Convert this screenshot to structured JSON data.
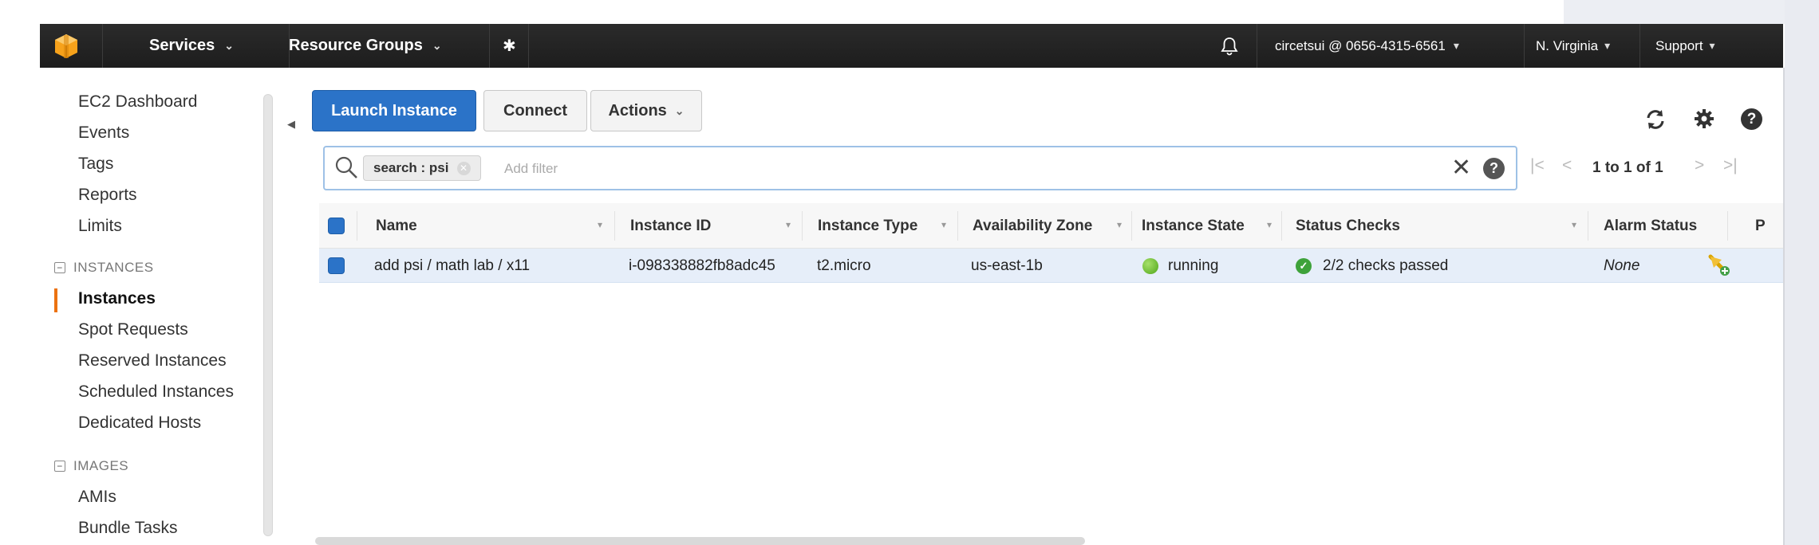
{
  "topbar": {
    "services": "Services",
    "resource_groups": "Resource Groups",
    "pin_icon": "pin-icon",
    "bell_icon": "bell-icon",
    "account": "circetsui @ 0656-4315-6561",
    "region": "N. Virginia",
    "support": "Support"
  },
  "sidebar": {
    "items": [
      "EC2 Dashboard",
      "Events",
      "Tags",
      "Reports",
      "Limits"
    ],
    "instances_group": "INSTANCES",
    "instances_items": [
      "Instances",
      "Spot Requests",
      "Reserved Instances",
      "Scheduled Instances",
      "Dedicated Hosts"
    ],
    "images_group": "IMAGES",
    "images_items": [
      "AMIs",
      "Bundle Tasks"
    ],
    "active": "Instances"
  },
  "toolbar": {
    "launch": "Launch Instance",
    "connect": "Connect",
    "actions": "Actions"
  },
  "search": {
    "token": "search : psi",
    "placeholder": "Add filter"
  },
  "pagination": {
    "text": "1 to 1 of 1"
  },
  "table": {
    "columns": [
      "Name",
      "Instance ID",
      "Instance Type",
      "Availability Zone",
      "Instance State",
      "Status Checks",
      "Alarm Status",
      "P"
    ],
    "rows": [
      {
        "name": "add psi / math lab / x11",
        "instance_id": "i-098338882fb8adc45",
        "instance_type": "t2.micro",
        "availability_zone": "us-east-1b",
        "state": "running",
        "status_checks": "2/2 checks passed",
        "alarm_status": "None"
      }
    ]
  },
  "colors": {
    "accent": "#2b73c8",
    "nav_bg": "#232323",
    "active_marker": "#ec7211",
    "running": "#4fa61a"
  }
}
